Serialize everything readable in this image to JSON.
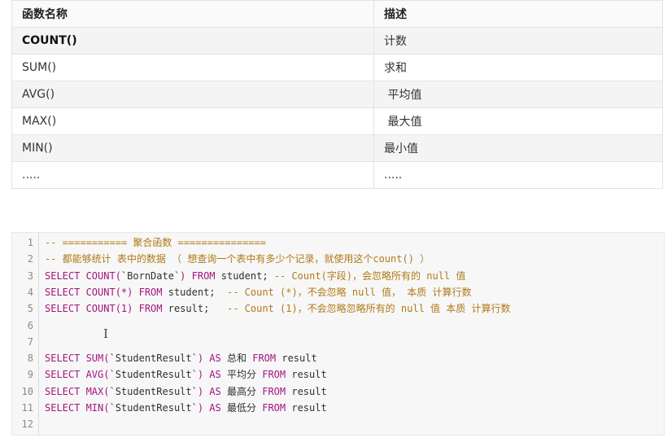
{
  "table": {
    "headers": [
      "函数名称",
      "描述"
    ],
    "rows": [
      {
        "name": "COUNT()",
        "desc": "计数"
      },
      {
        "name": "SUM()",
        "desc": "求和"
      },
      {
        "name": "AVG()",
        "desc": " 平均值"
      },
      {
        "name": "MAX()",
        "desc": " 最大值"
      },
      {
        "name": "MIN()",
        "desc": "最小值"
      },
      {
        "name": ".....",
        "desc": "....."
      }
    ]
  },
  "code": {
    "lines": [
      {
        "n": "1",
        "seg": [
          {
            "c": "cm",
            "t": "-- =========== 聚合函数 ==============="
          }
        ]
      },
      {
        "n": "2",
        "seg": [
          {
            "c": "cm",
            "t": "-- 都能够统计 表中的数据 （ 想查询一个表中有多少个记录，就使用这个count() ）"
          }
        ]
      },
      {
        "n": "3",
        "seg": [
          {
            "c": "kw",
            "t": "SELECT COUNT("
          },
          {
            "c": "id",
            "t": "`BornDate`"
          },
          {
            "c": "kw",
            "t": ") FROM "
          },
          {
            "c": "id",
            "t": "student; "
          },
          {
            "c": "cm",
            "t": "-- Count(字段)，会忽略所有的 null 值"
          }
        ]
      },
      {
        "n": "4",
        "seg": [
          {
            "c": "kw",
            "t": "SELECT COUNT(*) FROM "
          },
          {
            "c": "id",
            "t": "student;  "
          },
          {
            "c": "cm",
            "t": "-- Count (*)，不会忽略 null 值， 本质 计算行数"
          }
        ]
      },
      {
        "n": "5",
        "seg": [
          {
            "c": "kw",
            "t": "SELECT COUNT(1) FROM "
          },
          {
            "c": "id",
            "t": "result;   "
          },
          {
            "c": "cm",
            "t": "-- Count (1)，不会忽略忽略所有的 null 值 本质 计算行数"
          }
        ]
      },
      {
        "n": "6",
        "seg": []
      },
      {
        "n": "7",
        "seg": []
      },
      {
        "n": "8",
        "seg": [
          {
            "c": "kw",
            "t": "SELECT SUM("
          },
          {
            "c": "id",
            "t": "`StudentResult`"
          },
          {
            "c": "kw",
            "t": ") AS "
          },
          {
            "c": "id",
            "t": "总和 "
          },
          {
            "c": "kw",
            "t": "FROM "
          },
          {
            "c": "id",
            "t": "result"
          }
        ]
      },
      {
        "n": "9",
        "seg": [
          {
            "c": "kw",
            "t": "SELECT AVG("
          },
          {
            "c": "id",
            "t": "`StudentResult`"
          },
          {
            "c": "kw",
            "t": ") AS "
          },
          {
            "c": "id",
            "t": "平均分 "
          },
          {
            "c": "kw",
            "t": "FROM "
          },
          {
            "c": "id",
            "t": "result"
          }
        ]
      },
      {
        "n": "10",
        "seg": [
          {
            "c": "kw",
            "t": "SELECT MAX("
          },
          {
            "c": "id",
            "t": "`StudentResult`"
          },
          {
            "c": "kw",
            "t": ") AS "
          },
          {
            "c": "id",
            "t": "最高分 "
          },
          {
            "c": "kw",
            "t": "FROM "
          },
          {
            "c": "id",
            "t": "result"
          }
        ]
      },
      {
        "n": "11",
        "seg": [
          {
            "c": "kw",
            "t": "SELECT MIN("
          },
          {
            "c": "id",
            "t": "`StudentResult`"
          },
          {
            "c": "kw",
            "t": ") AS "
          },
          {
            "c": "id",
            "t": "最低分 "
          },
          {
            "c": "kw",
            "t": "FROM "
          },
          {
            "c": "id",
            "t": "result"
          }
        ]
      },
      {
        "n": "12",
        "seg": []
      }
    ]
  },
  "cursor_glyph": "I"
}
